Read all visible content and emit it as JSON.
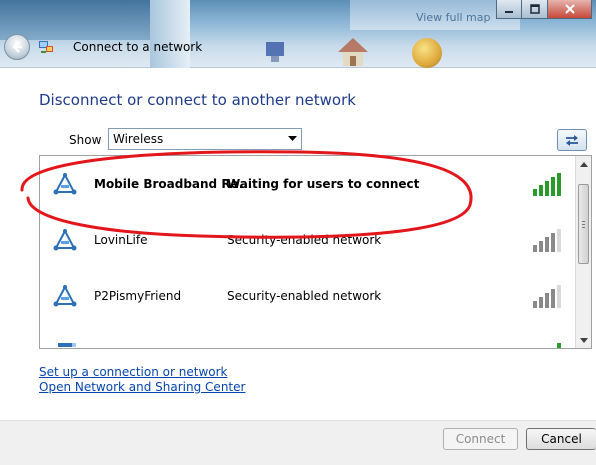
{
  "window": {
    "title": "Connect to a network",
    "background_link": "View full map"
  },
  "main": {
    "heading": "Disconnect or connect to another network",
    "show_label": "Show",
    "show_selected": "Wireless"
  },
  "networks": [
    {
      "name": "Mobile Broadband Re...",
      "status": "Waiting for users to connect",
      "signal_bars": 5,
      "signal_color": "#2a9a2a",
      "highlighted": true
    },
    {
      "name": "LovinLife",
      "status": "Security-enabled network",
      "signal_bars": 4,
      "signal_color": "#8a8a8a",
      "highlighted": false
    },
    {
      "name": "P2PismyFriend",
      "status": "Security-enabled network",
      "signal_bars": 4,
      "signal_color": "#8a8a8a",
      "highlighted": false
    }
  ],
  "links": {
    "setup": "Set up a connection or network",
    "sharing_center": "Open Network and Sharing Center"
  },
  "buttons": {
    "connect": "Connect",
    "cancel": "Cancel"
  },
  "colors": {
    "heading": "#1e3a8a",
    "link": "#0645ad",
    "annotation": "#e3161c"
  }
}
